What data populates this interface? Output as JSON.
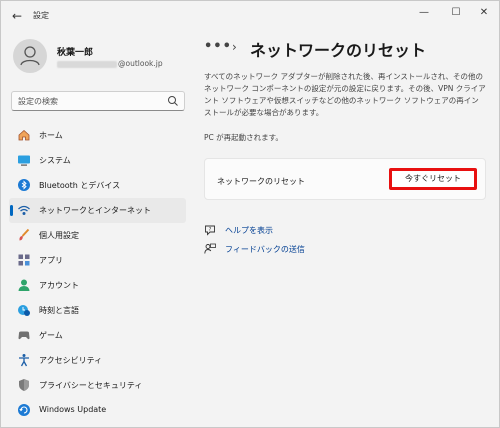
{
  "titlebar": {
    "app_title": "設定",
    "back_glyph": "←",
    "minimize_glyph": "—",
    "maximize_glyph": "☐",
    "close_glyph": "✕"
  },
  "profile": {
    "name": "秋葉一郎",
    "email_suffix": "@outlook.jp"
  },
  "search": {
    "placeholder": "設定の検索"
  },
  "sidebar": {
    "items": [
      {
        "label": "ホーム",
        "icon": "home-icon",
        "active": false
      },
      {
        "label": "システム",
        "icon": "system-icon",
        "active": false
      },
      {
        "label": "Bluetooth とデバイス",
        "icon": "bluetooth-icon",
        "active": false
      },
      {
        "label": "ネットワークとインターネット",
        "icon": "network-icon",
        "active": true
      },
      {
        "label": "個人用設定",
        "icon": "brush-icon",
        "active": false
      },
      {
        "label": "アプリ",
        "icon": "apps-icon",
        "active": false
      },
      {
        "label": "アカウント",
        "icon": "account-icon",
        "active": false
      },
      {
        "label": "時刻と言語",
        "icon": "time-language-icon",
        "active": false
      },
      {
        "label": "ゲーム",
        "icon": "gaming-icon",
        "active": false
      },
      {
        "label": "アクセシビリティ",
        "icon": "accessibility-icon",
        "active": false
      },
      {
        "label": "プライバシーとセキュリティ",
        "icon": "shield-icon",
        "active": false
      },
      {
        "label": "Windows Update",
        "icon": "windows-update-icon",
        "active": false
      }
    ]
  },
  "main": {
    "breadcrumb_more": "•••",
    "breadcrumb_sep": "›",
    "title": "ネットワークのリセット",
    "description": "すべてのネットワーク アダプターが削除された後、再インストールされ、その他のネットワーク コンポーネントの設定が元の設定に戻ります。その後、VPN クライアント ソフトウェアや仮想スイッチなどの他のネットワーク ソフトウェアの再インストールが必要な場合があります。",
    "restart_note": "PC が再起動されます。",
    "card": {
      "label": "ネットワークのリセット",
      "button": "今すぐリセット"
    },
    "links": {
      "help": "ヘルプを表示",
      "feedback": "フィードバックの送信"
    }
  },
  "colors": {
    "accent": "#0067c0",
    "highlight_border": "#e81010",
    "link": "#003e92"
  }
}
